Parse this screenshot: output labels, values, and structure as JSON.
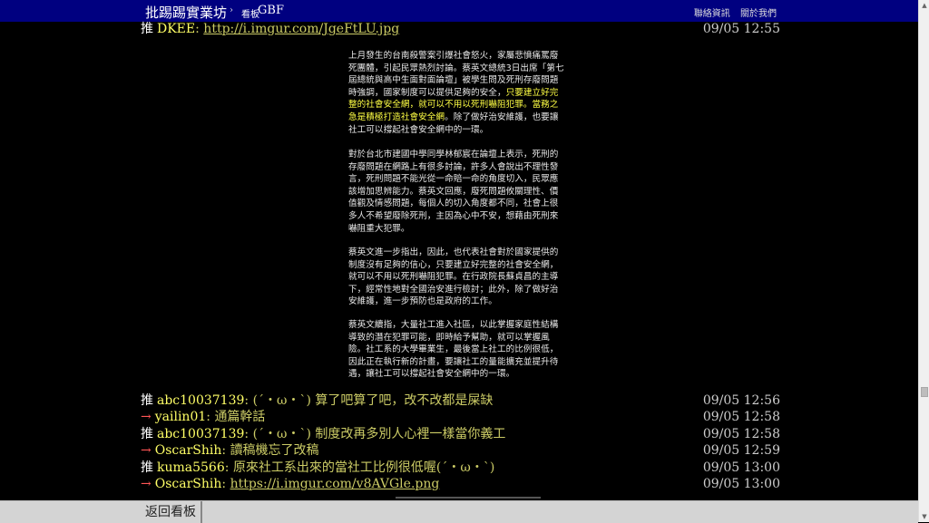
{
  "topbar": {
    "site_title": "批踢踢實業坊",
    "separator": "›",
    "board_prefix": "看板",
    "board_name": "GBF",
    "links": [
      "聯絡資訊",
      "關於我們"
    ]
  },
  "first_push": {
    "tag": "推",
    "user": "DKEE",
    "content": "http://i.imgur.com/JgeFtLU.jpg",
    "time": "09/05 12:55"
  },
  "article_image": {
    "paragraphs": [
      {
        "before": "上月發生的台南殺警案引爆社會怒火，家屬悲憤痛罵廢死團體，引起民眾熱烈討論。蔡英文總統3日出席「第七屆總統與高中生面對面論壇」被學生問及死刑存廢問題時強調，國家制度可以提供足夠的安全，",
        "highlight": "只要建立好完整的社會安全網，就可以不用以死刑嚇阻犯罪。當務之急是積極打造社會安全網",
        "after": "。除了做好治安維護，也要讓社工可以撐起社會安全網中的一環。"
      },
      {
        "text": "對於台北市建國中學同學林郁宸在論壇上表示，死刑的存廢問題在網路上有很多討論，許多人會說出不理性發言，死刑問題不能光從一命賠一命的角度切入，民眾應該增加思辨能力。蔡英文回應，廢死問題攸關理性、價值觀及情感問題，每個人的切入角度都不同，社會上很多人不希望廢除死刑，主因為心中不安，想藉由死刑來嚇阻重大犯罪。"
      },
      {
        "text": "蔡英文進一步指出，因此，也代表社會對於國家提供的制度沒有足夠的信心，只要建立好完整的社會安全網，就可以不用以死刑嚇阻犯罪。在行政院長蘇貞昌的主導下，經常性地對全國治安進行檢討；此外，除了做好治安維護，進一步預防也是政府的工作。"
      },
      {
        "text": "蔡英文續指，大量社工進入社區，以此掌握家庭性結構導致的潛在犯罪可能，即時給予幫助，就可以掌握風險。社工系的大學畢業生，最後當上社工的比例很低，因此正在執行新的計畫，要讓社工的量能擴充並提升待遇，讓社工可以撐起社會安全網中的一環。"
      }
    ]
  },
  "pushes": [
    {
      "tag": "推",
      "user": "abc10037139",
      "content": "(ˊ・ω・ˋ) 算了吧算了吧，改不改都是屎缺",
      "time": "09/05 12:56"
    },
    {
      "tag": "→",
      "user": "yailin01",
      "content": "通篇幹話",
      "time": "09/05 12:58"
    },
    {
      "tag": "推",
      "user": "abc10037139",
      "content": "(ˊ・ω・ˋ) 制度改再多別人心裡一樣當你義工",
      "time": "09/05 12:58"
    },
    {
      "tag": "→",
      "user": "OscarShih",
      "content": "讀稿機忘了改稿",
      "time": "09/05 12:59"
    },
    {
      "tag": "推",
      "user": "kuma5566",
      "content": "原來社工系出來的當社工比例很低喔(ˊ・ω・ˋ)",
      "time": "09/05 13:00"
    },
    {
      "tag": "→",
      "user": "OscarShih",
      "content": "https://i.imgur.com/v8AVGle.png",
      "time": "09/05 13:00"
    }
  ],
  "bottombar": {
    "back_label": "返回看板"
  },
  "scrollbar": {
    "up_glyph": "▲",
    "down_glyph": "▼"
  },
  "colors": {
    "topbar_bg": "#000080",
    "push_user": "#ffff66",
    "push_content": "#cccc66",
    "arrow_tag": "#ff5555",
    "highlight": "#ffff44"
  }
}
